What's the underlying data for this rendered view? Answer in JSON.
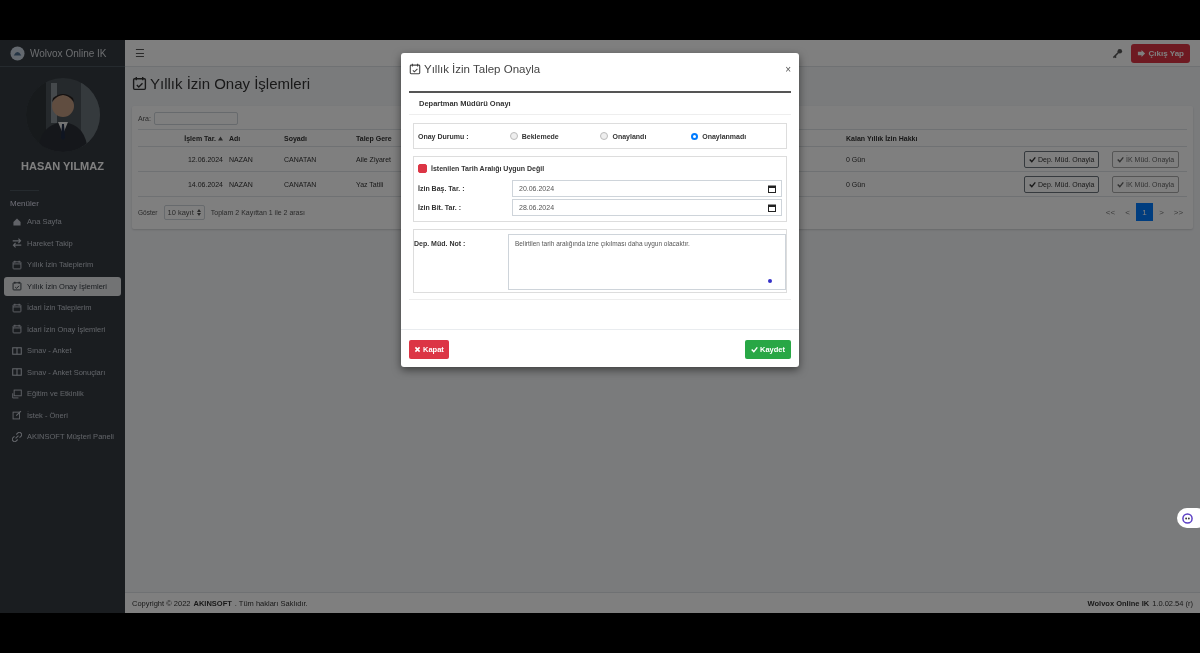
{
  "sidebar": {
    "brand": "Wolvox Online IK",
    "user_name": "HASAN YILMAZ",
    "section_label": "Menüler",
    "items": [
      {
        "label": "Ana Sayfa",
        "kind": "home",
        "selected": false
      },
      {
        "label": "Hareket Takip",
        "kind": "arrows",
        "selected": false
      },
      {
        "label": "Yıllık İzin Taleplerim",
        "kind": "calendar",
        "selected": false
      },
      {
        "label": "Yıllık İzin Onay İşlemleri",
        "kind": "check",
        "selected": true
      },
      {
        "label": "İdari İzin Taleplerim",
        "kind": "calendar",
        "selected": false
      },
      {
        "label": "İdari İzin Onay İşlemleri",
        "kind": "calendar",
        "selected": false
      },
      {
        "label": "Sınav - Anket",
        "kind": "book",
        "selected": false
      },
      {
        "label": "Sınav - Anket Sonuçları",
        "kind": "book",
        "selected": false
      },
      {
        "label": "Eğitim ve Etkinlik",
        "kind": "screen",
        "selected": false
      },
      {
        "label": "İstek - Öneri",
        "kind": "edit",
        "selected": false
      },
      {
        "label": "AKINSOFT Müşteri Paneli",
        "kind": "link",
        "selected": false
      }
    ]
  },
  "topbar": {
    "menu_glyph": "☰",
    "logout": "Çıkış Yap"
  },
  "page": {
    "title": "Yıllık İzin Onay İşlemleri",
    "search_label": "Ara:",
    "table": {
      "columns": [
        {
          "label": "İşlem Tar.",
          "sorted": true
        },
        {
          "label": "Adı",
          "sorted": false
        },
        {
          "label": "Soyadı",
          "sorted": false
        },
        {
          "label": "Talep Gere",
          "sorted": false
        },
        {
          "label": "Kalan Yıllık İzin Hakkı",
          "sorted": false
        }
      ],
      "rows": [
        {
          "cells": [
            "12.06.2024",
            "NAZAN",
            "CANATAN",
            "Aile Ziyaret",
            "0 Gün"
          ],
          "dep_button": "Dep. Müd. Onayla",
          "ik_button": "İK Müd. Onayla",
          "ik_disabled": true
        },
        {
          "cells": [
            "14.06.2024",
            "NAZAN",
            "CANATAN",
            "Yaz Tatili",
            "0 Gün"
          ],
          "dep_button": "Dep. Müd. Onayla",
          "ik_button": "İK Müd. Onayla",
          "ik_disabled": true
        }
      ]
    },
    "length_label": "Göster",
    "length_value": "10 kayıt",
    "info": "Toplam 2 Kayıttan 1 ile 2 arası",
    "pagination": [
      {
        "label": "<<",
        "selected": false
      },
      {
        "label": "<",
        "selected": false
      },
      {
        "label": "1",
        "selected": true
      },
      {
        "label": ">",
        "selected": false
      },
      {
        "label": ">>",
        "selected": false
      }
    ]
  },
  "footer": {
    "copyright": "Copyright © 2022",
    "company": "AKINSOFT",
    "rights": ". Tüm hakları Saklıdır.",
    "product": "Wolvox Online IK",
    "version": "1.0.02.54 (r)"
  },
  "modal": {
    "title": "Yıllık İzin Talep Onayla",
    "close": "×",
    "section": "Departman Müdürü Onayı",
    "status_label": "Onay Durumu :",
    "status_options": [
      {
        "label": "Beklemede",
        "selected": false
      },
      {
        "label": "Onaylandı",
        "selected": false
      },
      {
        "label": "Onaylanmadı",
        "selected": true
      }
    ],
    "unsuitable": {
      "label": "İstenilen Tarih Aralığı Uygun Değil",
      "checked": true
    },
    "start_label": "İzin Baş. Tar. :",
    "start_value": "20.06.2024",
    "end_label": "İzin Bit. Tar. :",
    "end_value": "28.06.2024",
    "note_label": "Dep. Müd. Not :",
    "note_value": "Belirtilen tarih aralığında izne çıkılması daha uygun olacaktır.",
    "close_button": "Kapat",
    "save_button": "Kaydet"
  }
}
